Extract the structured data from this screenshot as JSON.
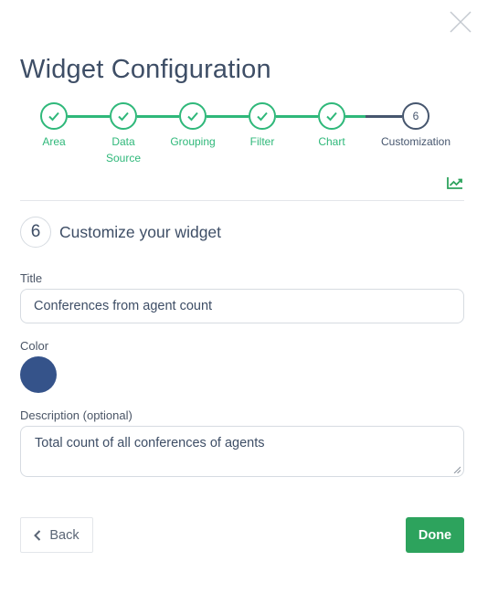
{
  "dialog": {
    "title": "Widget Configuration",
    "close_icon": "close-icon"
  },
  "stepper": {
    "steps": [
      {
        "label": "Area",
        "state": "completed"
      },
      {
        "label": "Data Source",
        "state": "completed"
      },
      {
        "label": "Grouping",
        "state": "completed"
      },
      {
        "label": "Filter",
        "state": "completed"
      },
      {
        "label": "Chart",
        "state": "completed"
      },
      {
        "label": "Customization",
        "state": "current",
        "number": "6"
      }
    ],
    "completed_color": "#2fb87a",
    "current_color": "#46566e"
  },
  "trend_icon": "trend-chart-icon",
  "section": {
    "number": "6",
    "title": "Customize your widget"
  },
  "form": {
    "title_label": "Title",
    "title_value": "Conferences from agent count",
    "color_label": "Color",
    "color_value": "#35538a",
    "description_label": "Description (optional)",
    "description_value": "Total count of all conferences of agents"
  },
  "actions": {
    "back_label": "Back",
    "done_label": "Done",
    "done_color": "#2da35d"
  }
}
